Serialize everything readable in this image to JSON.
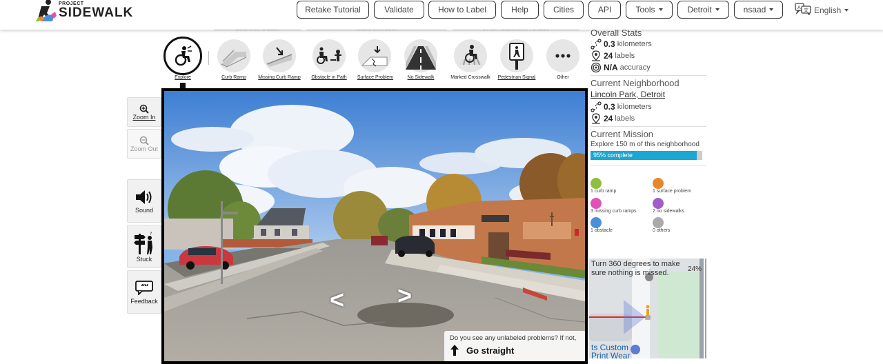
{
  "app": {
    "logo_small": "PROJECT",
    "logo_big": "SIDEWALK"
  },
  "nav": {
    "retake_tutorial": "Retake Tutorial",
    "validate": "Validate",
    "how_to_label": "How to Label",
    "help": "Help",
    "cities": "Cities",
    "api": "API",
    "tools": "Tools",
    "city": "Detroit",
    "user": "nsaad",
    "language": "English"
  },
  "toolbar": {
    "categories": {
      "curb_ramp": "CURB RAMP LABELS",
      "sidewalk": "SIDEWALK LABELS",
      "other": "OTHER ACCESSIBILITY LABELS"
    },
    "tools": [
      {
        "key": "explore",
        "label": "Explore"
      },
      {
        "key": "curb-ramp",
        "label": "Curb Ramp"
      },
      {
        "key": "missing-curb-ramp",
        "label": "Missing Curb Ramp"
      },
      {
        "key": "obstacle",
        "label": "Obstacle in Path"
      },
      {
        "key": "surface-problem",
        "label": "Surface Problem"
      },
      {
        "key": "no-sidewalk",
        "label": "No Sidewalk"
      },
      {
        "key": "marked-crosswalk",
        "label": "Marked Crosswalk"
      },
      {
        "key": "pedestrian-signal",
        "label": "Pedestrian Signal"
      },
      {
        "key": "other",
        "label": "Other"
      }
    ]
  },
  "side": {
    "zoom_in": "Zoom In",
    "zoom_out": "Zoom Out",
    "sound": "Sound",
    "stuck": "Stuck",
    "feedback": "Feedback"
  },
  "pano": {
    "prompt_question": "Do you see any unlabeled problems? If not,",
    "prompt_action": "Go straight"
  },
  "stats": {
    "overall_title": "Overall Stats",
    "overall_km": "0.3",
    "overall_labels": "24",
    "overall_accuracy": "N/A",
    "unit_km": "kilometers",
    "unit_labels": "labels",
    "unit_accuracy": "accuracy",
    "neighborhood_title": "Current Neighborhood",
    "neighborhood_name": "Lincoln Park, Detroit",
    "neighborhood_km": "0.3",
    "neighborhood_labels": "24",
    "mission_title": "Current Mission",
    "mission_desc": "Explore 150 m of this neighborhood",
    "mission_progress_text": "95% complete",
    "mission_progress": 95
  },
  "label_counts": [
    {
      "key": "curb-ramp",
      "text": "1 curb ramp",
      "color": "#8fbf3f"
    },
    {
      "key": "surface-problem",
      "text": "1 surface problem",
      "color": "#e8872a"
    },
    {
      "key": "missing-curb-ramp",
      "text": "3 missing curb ramps",
      "color": "#e052b8"
    },
    {
      "key": "no-sidewalk",
      "text": "2 no sidewalks",
      "color": "#a15ec7"
    },
    {
      "key": "obstacle",
      "text": "1 obstacle",
      "color": "#4a90d9"
    },
    {
      "key": "other",
      "text": "0 others",
      "color": "#aaaaaa"
    }
  ],
  "minimap": {
    "instruction": "Turn 360 degrees to make sure nothing is missed.",
    "percent": "24%",
    "poi_line1": "ts Custom",
    "poi_line2": "Print Wear"
  },
  "colors": {
    "progress": "#1aa7d1",
    "accent_red": "#e0262c"
  }
}
